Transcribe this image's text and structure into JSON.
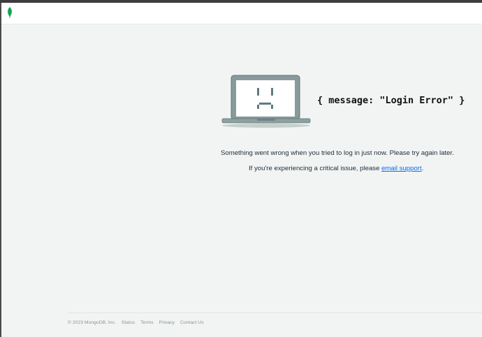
{
  "header": {
    "logo_icon": "mongodb-leaf-icon"
  },
  "error": {
    "illustration_icon": "sad-laptop-icon",
    "code_text": "{ message: \"Login Error\" }",
    "message": "Something went wrong when you tried to log in just now. Please try again later.",
    "support_prefix": "If you're experiencing a critical issue, please ",
    "support_link": "email support",
    "support_suffix": "."
  },
  "footer": {
    "copyright": "© 2023 MongoDB, Inc.",
    "links": [
      "Status",
      "Terms",
      "Privacy",
      "Contact Us"
    ]
  },
  "colors": {
    "background": "#f2f4f3",
    "link": "#016bf8",
    "brand_green": "#13aa52"
  }
}
